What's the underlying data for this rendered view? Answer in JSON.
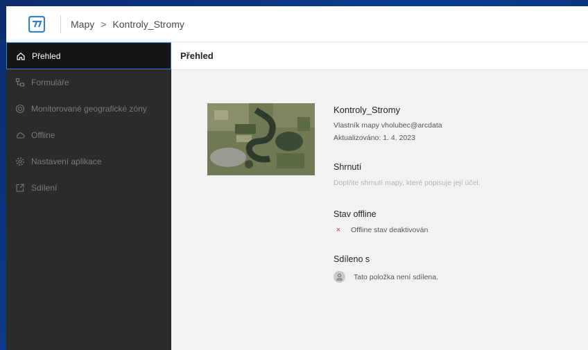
{
  "breadcrumb": {
    "root": "Mapy",
    "current": "Kontroly_Stromy"
  },
  "sidebar": {
    "items": [
      {
        "label": "Přehled",
        "icon": "home-icon"
      },
      {
        "label": "Formuláře",
        "icon": "form-icon"
      },
      {
        "label": "Monitorované geografické zóny",
        "icon": "geofence-icon"
      },
      {
        "label": "Offline",
        "icon": "cloud-offline-icon"
      },
      {
        "label": "Nastavení aplikace",
        "icon": "gear-icon"
      },
      {
        "label": "Sdílení",
        "icon": "share-icon"
      }
    ]
  },
  "main": {
    "header": "Přehled",
    "title": "Kontroly_Stromy",
    "owner": "Vlastník mapy vholubec@arcdata",
    "updated": "Aktualizováno: 1. 4. 2023",
    "summary_heading": "Shrnutí",
    "summary_placeholder": "Doplňte shrnutí mapy, které popisuje její účel.",
    "offline_heading": "Stav offline",
    "offline_status": "Offline stav deaktivován",
    "offline_mark": "×",
    "shared_heading": "Sdíleno s",
    "shared_status": "Tato položka není sdílena."
  },
  "colors": {
    "accent": "#2f80d6",
    "sidebar_bg": "#2b2b2b",
    "sidebar_active_bg": "#151515",
    "error": "#d83020",
    "content_bg": "#f2f2f2"
  }
}
